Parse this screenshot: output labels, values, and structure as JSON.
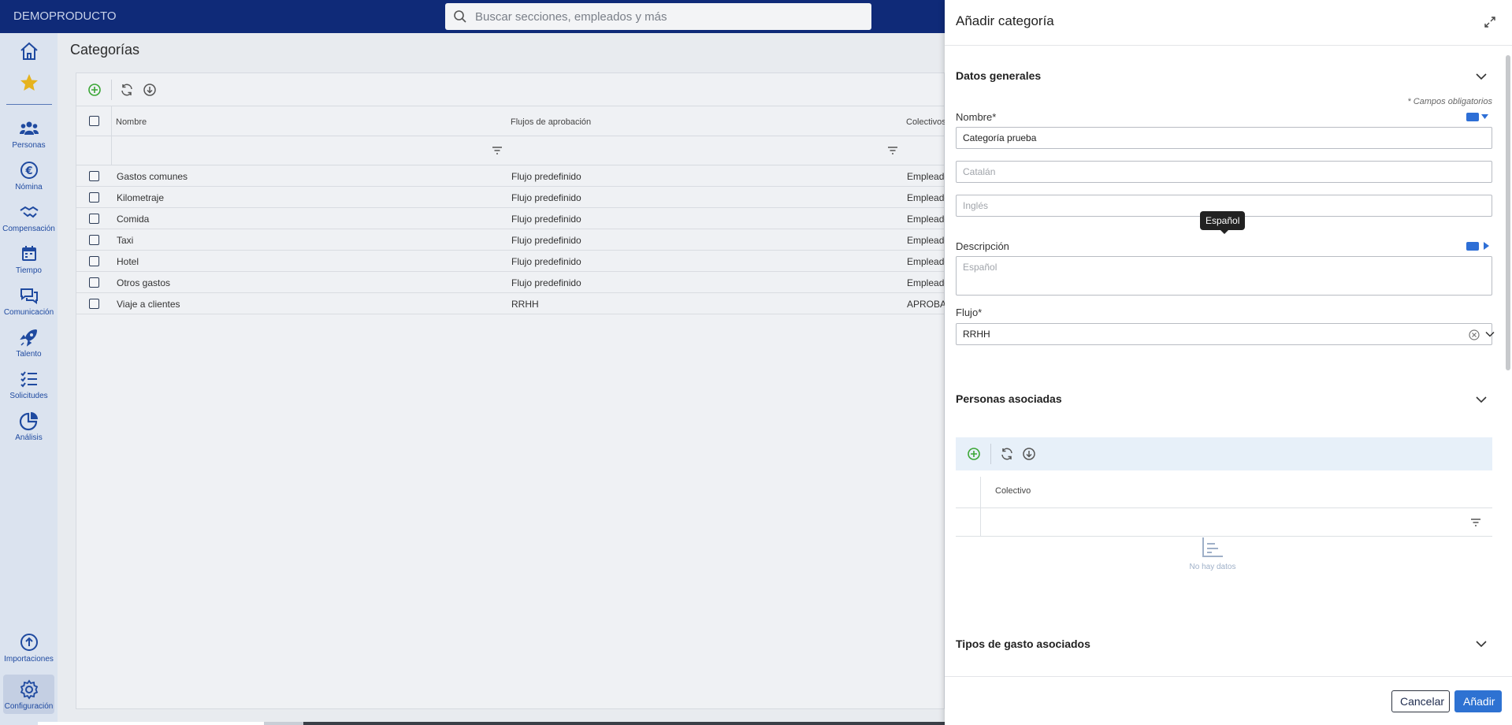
{
  "app": {
    "brand": "DEMOPRODUCTO"
  },
  "search": {
    "placeholder": "Buscar secciones, empleados y más"
  },
  "nav": {
    "items": [
      {
        "label": "Personas"
      },
      {
        "label": "Nómina"
      },
      {
        "label": "Compensación"
      },
      {
        "label": "Tiempo"
      },
      {
        "label": "Comunicación"
      },
      {
        "label": "Talento"
      },
      {
        "label": "Solicitudes"
      },
      {
        "label": "Análisis"
      },
      {
        "label": "Importaciones"
      },
      {
        "label": "Configuración"
      }
    ]
  },
  "main": {
    "title": "Categorías",
    "columns": [
      "Nombre",
      "Flujos de aprobación",
      "Colectivos"
    ],
    "rows": [
      {
        "name": "Gastos comunes",
        "flow": "Flujo predefinido",
        "group": "Empleado"
      },
      {
        "name": "Kilometraje",
        "flow": "Flujo predefinido",
        "group": "Empleado"
      },
      {
        "name": "Comida",
        "flow": "Flujo predefinido",
        "group": "Empleado"
      },
      {
        "name": "Taxi",
        "flow": "Flujo predefinido",
        "group": "Empleado"
      },
      {
        "name": "Hotel",
        "flow": "Flujo predefinido",
        "group": "Empleado"
      },
      {
        "name": "Otros gastos",
        "flow": "Flujo predefinido",
        "group": "Empleado"
      },
      {
        "name": "Viaje a clientes",
        "flow": "RRHH",
        "group": "APROBAD"
      }
    ]
  },
  "panel": {
    "title": "Añadir categoría",
    "general": {
      "title": "Datos generales",
      "required_note": "* Campos obligatorios",
      "name_label": "Nombre*",
      "name_value": "Categoría prueba",
      "catalan_placeholder": "Catalán",
      "english_placeholder": "Inglés",
      "tooltip": "Español",
      "description_label": "Descripción",
      "description_placeholder": "Español",
      "flow_label": "Flujo*",
      "flow_value": "RRHH"
    },
    "people": {
      "title": "Personas asociadas",
      "column": "Colectivo",
      "empty": "No hay datos"
    },
    "expense_types": {
      "title": "Tipos de gasto asociados"
    },
    "cancel_label": "Cancelar",
    "add_label": "Añadir"
  },
  "colors": {
    "topbar": "#0f2a78",
    "accent": "#2e72d2",
    "add_green": "#3aa635"
  }
}
